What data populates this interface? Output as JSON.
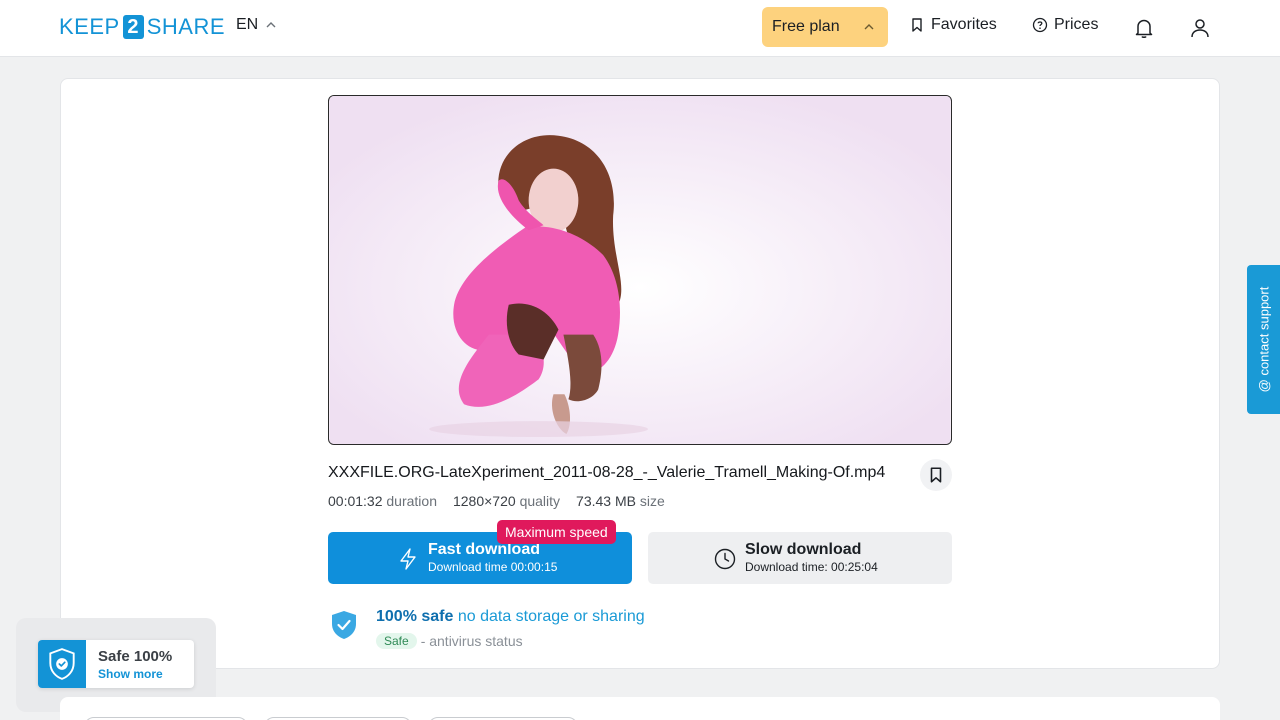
{
  "header": {
    "logo_left": "KEEP",
    "logo_mid": "2",
    "logo_right": "SHARE",
    "language": "EN",
    "plan": "Free plan",
    "favorites": "Favorites",
    "prices": "Prices"
  },
  "file": {
    "name": "XXXFILE.ORG-LateXperiment_2011-08-28_-_Valerie_Tramell_Making-Of.mp4",
    "duration_value": "00:01:32",
    "duration_label": "duration",
    "quality_value": "1280×720",
    "quality_label": "quality",
    "size_value": "73.43 MB",
    "size_label": "size"
  },
  "download": {
    "badge": "Maximum speed",
    "fast_title": "Fast download",
    "fast_sub": "Download time 00:00:15",
    "slow_title": "Slow download",
    "slow_sub": "Download time: 00:25:04"
  },
  "safety": {
    "title_bold": "100% safe",
    "title_rest": " no data storage or sharing",
    "status_pill": "Safe",
    "status_text": "- antivirus status"
  },
  "support_tab": "@ contact support",
  "safe_widget": {
    "title": "Safe 100%",
    "more": "Show more"
  },
  "colors": {
    "brand": "#1393d6",
    "plan_bg": "#fdd27e",
    "badge": "#e0195c",
    "fast_btn": "#0f8fdb"
  }
}
